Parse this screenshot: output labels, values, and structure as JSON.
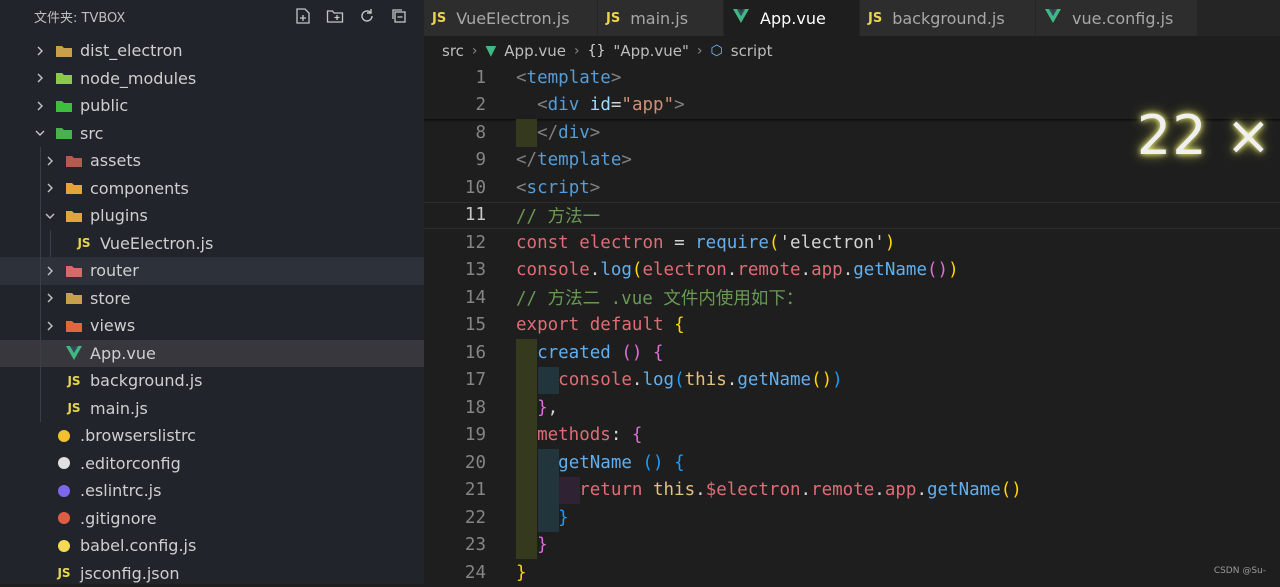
{
  "explorer": {
    "title": "文件夹: TVBOX",
    "actions": [
      {
        "name": "new-file-icon"
      },
      {
        "name": "new-folder-icon"
      },
      {
        "name": "refresh-icon"
      },
      {
        "name": "collapse-all-icon"
      }
    ],
    "tree": [
      {
        "label": "dist_electron",
        "depth": 0,
        "kind": "folder",
        "expanded": false,
        "icon": "folder-icon",
        "icon_color": "#c8a04b"
      },
      {
        "label": "node_modules",
        "depth": 0,
        "kind": "folder",
        "expanded": false,
        "icon": "node-folder-icon",
        "icon_color": "#8cc84b"
      },
      {
        "label": "public",
        "depth": 0,
        "kind": "folder",
        "expanded": false,
        "icon": "public-folder-icon",
        "icon_color": "#3dbf3d"
      },
      {
        "label": "src",
        "depth": 0,
        "kind": "folder",
        "expanded": true,
        "icon": "src-folder-icon",
        "icon_color": "#4caf50"
      },
      {
        "label": "assets",
        "depth": 1,
        "kind": "folder",
        "expanded": false,
        "icon": "assets-folder-icon",
        "icon_color": "#b55a4e"
      },
      {
        "label": "components",
        "depth": 1,
        "kind": "folder",
        "expanded": false,
        "icon": "components-folder-icon",
        "icon_color": "#e5a33b"
      },
      {
        "label": "plugins",
        "depth": 1,
        "kind": "folder",
        "expanded": true,
        "icon": "plugins-folder-icon",
        "icon_color": "#e5a33b"
      },
      {
        "label": "VueElectron.js",
        "depth": 2,
        "kind": "js",
        "icon": "js-file-icon",
        "icon_color": "#e8d44d"
      },
      {
        "label": "router",
        "depth": 1,
        "kind": "folder",
        "expanded": false,
        "icon": "router-folder-icon",
        "icon_color": "#d46a6a",
        "hover": true
      },
      {
        "label": "store",
        "depth": 1,
        "kind": "folder",
        "expanded": false,
        "icon": "store-folder-icon",
        "icon_color": "#c8a04b"
      },
      {
        "label": "views",
        "depth": 1,
        "kind": "folder",
        "expanded": false,
        "icon": "views-folder-icon",
        "icon_color": "#e0673b"
      },
      {
        "label": "App.vue",
        "depth": 1,
        "kind": "vue",
        "icon": "vue-file-icon",
        "icon_color": "#41b883",
        "selected": true
      },
      {
        "label": "background.js",
        "depth": 1,
        "kind": "js",
        "icon": "js-file-icon",
        "icon_color": "#e8d44d"
      },
      {
        "label": "main.js",
        "depth": 1,
        "kind": "js",
        "icon": "js-file-icon",
        "icon_color": "#e8d44d"
      },
      {
        "label": ".browserslistrc",
        "depth": 0,
        "kind": "file",
        "icon": "browserslist-icon",
        "icon_color": "#f2c12e"
      },
      {
        "label": ".editorconfig",
        "depth": 0,
        "kind": "file",
        "icon": "editorconfig-icon",
        "icon_color": "#e0e0e0"
      },
      {
        "label": ".eslintrc.js",
        "depth": 0,
        "kind": "file",
        "icon": "eslint-icon",
        "icon_color": "#7b68ee"
      },
      {
        "label": ".gitignore",
        "depth": 0,
        "kind": "file",
        "icon": "git-icon",
        "icon_color": "#e05d44"
      },
      {
        "label": "babel.config.js",
        "depth": 0,
        "kind": "file",
        "icon": "babel-icon",
        "icon_color": "#f5da55"
      },
      {
        "label": "jsconfig.json",
        "depth": 0,
        "kind": "js",
        "icon": "jsconfig-icon",
        "icon_color": "#e8d44d"
      }
    ]
  },
  "tabs": [
    {
      "label": "VueElectron.js",
      "icon": "js-file-icon",
      "icon_text": "JS",
      "icon_color": "#e8d44d",
      "active": false
    },
    {
      "label": "main.js",
      "icon": "js-file-icon",
      "icon_text": "JS",
      "icon_color": "#e8d44d",
      "active": false
    },
    {
      "label": "App.vue",
      "icon": "vue-file-icon",
      "icon_text": "",
      "icon_color": "#41b883",
      "active": true
    },
    {
      "label": "background.js",
      "icon": "js-file-icon",
      "icon_text": "JS",
      "icon_color": "#e8d44d",
      "active": false
    },
    {
      "label": "vue.config.js",
      "icon": "vue-config-icon",
      "icon_text": "",
      "icon_color": "#41b883",
      "active": false
    }
  ],
  "breadcrumb": {
    "parts": [
      "src",
      "App.vue",
      "\"App.vue\"",
      "script"
    ]
  },
  "editor": {
    "current_line": "11",
    "lines": [
      {
        "n": "1",
        "guides": 0,
        "tokens": [
          [
            "c-brk",
            "<"
          ],
          [
            "c-tag",
            "template"
          ],
          [
            "c-brk",
            ">"
          ]
        ]
      },
      {
        "n": "2",
        "guides": 0,
        "tokens": [
          [
            "c-pl",
            "  "
          ],
          [
            "c-brk",
            "<"
          ],
          [
            "c-tag",
            "div"
          ],
          [
            "c-pl",
            " "
          ],
          [
            "c-attr",
            "id"
          ],
          [
            "c-pl",
            "="
          ],
          [
            "c-str",
            "\"app\""
          ],
          [
            "c-brk",
            ">"
          ]
        ]
      },
      {
        "n": "8",
        "guides": 1,
        "tokens": [
          [
            "c-pl",
            "  "
          ],
          [
            "c-brk",
            "</"
          ],
          [
            "c-tag",
            "div"
          ],
          [
            "c-brk",
            ">"
          ]
        ]
      },
      {
        "n": "9",
        "guides": 0,
        "tokens": [
          [
            "c-brk",
            "</"
          ],
          [
            "c-tag",
            "template"
          ],
          [
            "c-brk",
            ">"
          ]
        ]
      },
      {
        "n": "10",
        "guides": 0,
        "tokens": [
          [
            "c-brk",
            "<"
          ],
          [
            "c-tag",
            "script"
          ],
          [
            "c-brk",
            ">"
          ]
        ]
      },
      {
        "n": "11",
        "guides": 0,
        "tokens": [
          [
            "c-cm",
            "// 方法一"
          ]
        ]
      },
      {
        "n": "12",
        "guides": 0,
        "tokens": [
          [
            "c-kw",
            "const"
          ],
          [
            "c-pl",
            " "
          ],
          [
            "c-var",
            "electron"
          ],
          [
            "c-pl",
            " = "
          ],
          [
            "c-fn",
            "require"
          ],
          [
            "c-p1",
            "("
          ],
          [
            "c-pl",
            "'electron'"
          ],
          [
            "c-p1",
            ")"
          ]
        ]
      },
      {
        "n": "13",
        "guides": 0,
        "tokens": [
          [
            "c-var",
            "console"
          ],
          [
            "c-pl",
            "."
          ],
          [
            "c-fn",
            "log"
          ],
          [
            "c-p1",
            "("
          ],
          [
            "c-var",
            "electron"
          ],
          [
            "c-pl",
            "."
          ],
          [
            "c-pr",
            "remote"
          ],
          [
            "c-pl",
            "."
          ],
          [
            "c-pr",
            "app"
          ],
          [
            "c-pl",
            "."
          ],
          [
            "c-fn",
            "getName"
          ],
          [
            "c-p2",
            "()"
          ],
          [
            "c-p1",
            ")"
          ]
        ]
      },
      {
        "n": "14",
        "guides": 0,
        "tokens": [
          [
            "c-cm",
            "// 方法二 .vue 文件内使用如下："
          ]
        ]
      },
      {
        "n": "15",
        "guides": 0,
        "tokens": [
          [
            "c-kw",
            "export"
          ],
          [
            "c-pl",
            " "
          ],
          [
            "c-kw",
            "default"
          ],
          [
            "c-pl",
            " "
          ],
          [
            "c-p1",
            "{"
          ]
        ]
      },
      {
        "n": "16",
        "guides": 1,
        "tokens": [
          [
            "c-pl",
            "  "
          ],
          [
            "c-fn",
            "created"
          ],
          [
            "c-pl",
            " "
          ],
          [
            "c-p2",
            "()"
          ],
          [
            "c-pl",
            " "
          ],
          [
            "c-p2",
            "{"
          ]
        ]
      },
      {
        "n": "17",
        "guides": 2,
        "tokens": [
          [
            "c-pl",
            "    "
          ],
          [
            "c-var",
            "console"
          ],
          [
            "c-pl",
            "."
          ],
          [
            "c-fn",
            "log"
          ],
          [
            "c-p3",
            "("
          ],
          [
            "c-th",
            "this"
          ],
          [
            "c-pl",
            "."
          ],
          [
            "c-fn",
            "getName"
          ],
          [
            "c-p1",
            "()"
          ],
          [
            "c-p3",
            ")"
          ]
        ]
      },
      {
        "n": "18",
        "guides": 1,
        "tokens": [
          [
            "c-pl",
            "  "
          ],
          [
            "c-p2",
            "}"
          ],
          [
            "c-pl",
            ","
          ]
        ]
      },
      {
        "n": "19",
        "guides": 1,
        "tokens": [
          [
            "c-pl",
            "  "
          ],
          [
            "c-kw",
            "methods"
          ],
          [
            "c-pl",
            ": "
          ],
          [
            "c-p2",
            "{"
          ]
        ]
      },
      {
        "n": "20",
        "guides": 2,
        "tokens": [
          [
            "c-pl",
            "    "
          ],
          [
            "c-fn",
            "getName"
          ],
          [
            "c-pl",
            " "
          ],
          [
            "c-p3",
            "()"
          ],
          [
            "c-pl",
            " "
          ],
          [
            "c-p3",
            "{"
          ]
        ]
      },
      {
        "n": "21",
        "guides": 3,
        "tokens": [
          [
            "c-pl",
            "      "
          ],
          [
            "c-kw",
            "return"
          ],
          [
            "c-pl",
            " "
          ],
          [
            "c-th",
            "this"
          ],
          [
            "c-pl",
            "."
          ],
          [
            "c-var",
            "$electron"
          ],
          [
            "c-pl",
            "."
          ],
          [
            "c-pr",
            "remote"
          ],
          [
            "c-pl",
            "."
          ],
          [
            "c-pr",
            "app"
          ],
          [
            "c-pl",
            "."
          ],
          [
            "c-fn",
            "getName"
          ],
          [
            "c-p1",
            "()"
          ]
        ]
      },
      {
        "n": "22",
        "guides": 2,
        "tokens": [
          [
            "c-pl",
            "    "
          ],
          [
            "c-p3",
            "}"
          ]
        ]
      },
      {
        "n": "23",
        "guides": 1,
        "tokens": [
          [
            "c-pl",
            "  "
          ],
          [
            "c-p2",
            "}"
          ]
        ]
      },
      {
        "n": "24",
        "guides": 0,
        "tokens": [
          [
            "c-p1",
            "}"
          ]
        ]
      }
    ]
  },
  "overlay_text": "22 ×",
  "watermark": "CSDN @Su-"
}
